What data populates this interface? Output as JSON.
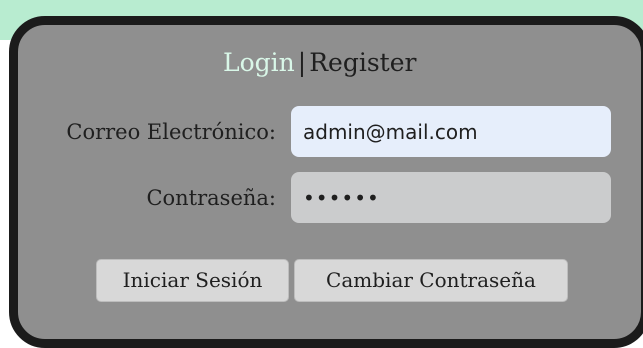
{
  "header": {
    "login_tab": "Login",
    "separator": "|",
    "register_tab": "Register"
  },
  "form": {
    "email_label": "Correo Electrónico:",
    "email_value": "admin@mail.com",
    "password_label": "Contraseña:",
    "password_value": "••••••"
  },
  "actions": {
    "login_button": "Iniciar Sesión",
    "change_password_button": "Cambiar Contraseña"
  },
  "colors": {
    "background_strip": "#b8ecd0",
    "card": "#8f8f8f",
    "card_border": "#1b1b1b",
    "active_tab": "#d9f7e8",
    "email_field": "#e6eefb",
    "password_field": "#cbcccd",
    "button": "#d8d8d8"
  }
}
